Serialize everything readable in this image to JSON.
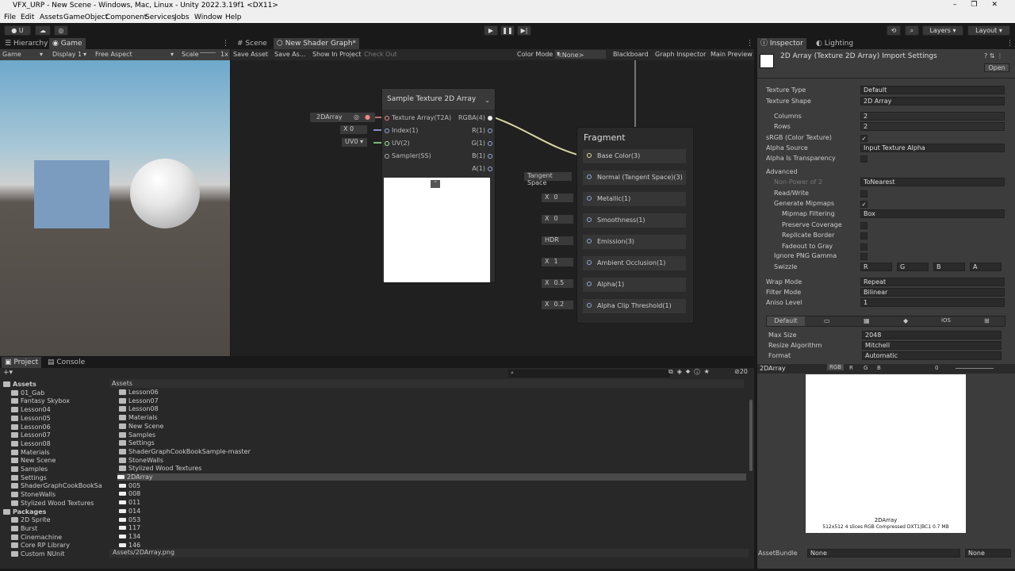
{
  "window": {
    "title": "VFX_URP - New Scene - Windows, Mac, Linux - Unity 2022.3.19f1 <DX11>"
  },
  "menu": [
    "File",
    "Edit",
    "Assets",
    "GameObject",
    "Component",
    "Services",
    "Jobs",
    "Window",
    "Help"
  ],
  "toolbar": {
    "account": "U",
    "layers": "Layers",
    "layout": "Layout"
  },
  "hierarchy_tabs": {
    "hierarchy": "Hierarchy",
    "game": "Game"
  },
  "game": {
    "mode": "Game",
    "display": "Display 1",
    "aspect": "Free Aspect",
    "scale_label": "Scale",
    "scale_value": "1x"
  },
  "sg_tabs": {
    "scene": "Scene",
    "shader": "New Shader Graph*"
  },
  "sg_toolbar": {
    "save": "Save Asset",
    "save_as": "Save As...",
    "show": "Show In Project",
    "checkout": "Check Out",
    "color_mode_label": "Color Mode",
    "color_mode": "<None>",
    "blackboard": "Blackboard",
    "graph_inspector": "Graph Inspector",
    "main_preview": "Main Preview"
  },
  "sample_node": {
    "title": "Sample Texture 2D Array",
    "inputs": [
      "Texture Array(T2A)",
      "Index(1)",
      "UV(2)",
      "Sampler(SS)"
    ],
    "outputs": [
      "RGBA(4)",
      "R(1)",
      "G(1)",
      "B(1)",
      "A(1)"
    ]
  },
  "prop_node": {
    "label": "2DArray",
    "index_x": "X",
    "index_val": "0",
    "uv": "UV0"
  },
  "fragment": {
    "title": "Fragment",
    "ports": [
      {
        "label": "Base Color(3)",
        "field": "",
        "val": ""
      },
      {
        "label": "Normal (Tangent Space)(3)",
        "field": "Tangent Space",
        "val": ""
      },
      {
        "label": "Metallic(1)",
        "field": "X",
        "val": "0"
      },
      {
        "label": "Smoothness(1)",
        "field": "X",
        "val": "0"
      },
      {
        "label": "Emission(3)",
        "field": "HDR",
        "val": ""
      },
      {
        "label": "Ambient Occlusion(1)",
        "field": "X",
        "val": "1"
      },
      {
        "label": "Alpha(1)",
        "field": "X",
        "val": "0.5"
      },
      {
        "label": "Alpha Clip Threshold(1)",
        "field": "X",
        "val": "0.2"
      }
    ]
  },
  "inspector_tabs": {
    "inspector": "Inspector",
    "lighting": "Lighting"
  },
  "inspector": {
    "title": "2D Array (Texture 2D Array) Import Settings",
    "open": "Open",
    "rows": [
      {
        "label": "Texture Type",
        "value": "Default"
      },
      {
        "label": "Texture Shape",
        "value": "2D Array"
      },
      {
        "label": "Columns",
        "value": "2"
      },
      {
        "label": "Rows",
        "value": "2"
      },
      {
        "label": "sRGB (Color Texture)",
        "value": "✓"
      },
      {
        "label": "Alpha Source",
        "value": "Input Texture Alpha"
      },
      {
        "label": "Alpha Is Transparency",
        "value": ""
      },
      {
        "label": "Advanced",
        "value": ""
      },
      {
        "label": "Non-Power of 2",
        "value": "ToNearest"
      },
      {
        "label": "Read/Write",
        "value": ""
      },
      {
        "label": "Generate Mipmaps",
        "value": "✓"
      },
      {
        "label": "Mipmap Filtering",
        "value": "Box"
      },
      {
        "label": "Preserve Coverage",
        "value": ""
      },
      {
        "label": "Replicate Border",
        "value": ""
      },
      {
        "label": "Fadeout to Gray",
        "value": ""
      },
      {
        "label": "Ignore PNG Gamma",
        "value": ""
      },
      {
        "label": "Swizzle",
        "value": "R"
      },
      {
        "label": "Wrap Mode",
        "value": "Repeat"
      },
      {
        "label": "Filter Mode",
        "value": "Bilinear"
      },
      {
        "label": "Aniso Level",
        "value": "1"
      }
    ],
    "swizzle": [
      "G",
      "B",
      "A"
    ],
    "platform_default": "Default",
    "platform_ios": "iOS",
    "max_size_label": "Max Size",
    "max_size": "2048",
    "resize_label": "Resize Algorithm",
    "resize": "Mitchell",
    "format_label": "Format",
    "format": "Automatic",
    "preview_name": "2DArray",
    "rgb": "RGB",
    "r": "R",
    "g": "G",
    "b": "B",
    "mip": "0",
    "preview_caption1": "2DArray",
    "preview_caption2": "512x512 4 slices RGB Compressed DXT1|BC1 0.7 MB",
    "assetbundle_label": "AssetBundle",
    "assetbundle": "None",
    "variant": "None"
  },
  "project_tabs": {
    "project": "Project",
    "console": "Console"
  },
  "project_tree": [
    "Assets",
    "01_Gab",
    "Fantasy Skybox",
    "Lesson04",
    "Lesson05",
    "Lesson06",
    "Lesson07",
    "Lesson08",
    "Materials",
    "New Scene",
    "Samples",
    "Settings",
    "ShaderGraphCookBookSa",
    "StoneWalls",
    "Stylized Wood Textures",
    "Packages",
    "2D Sprite",
    "Burst",
    "Cinemachine",
    "Core RP Library",
    "Custom NUnit"
  ],
  "breadcrumb": "Assets",
  "project_files": [
    "Lesson06",
    "Lesson07",
    "Lesson08",
    "Materials",
    "New Scene",
    "Samples",
    "Settings",
    "ShaderGraphCookBookSample-master",
    "StoneWalls",
    "Stylized Wood Textures",
    "2DArray",
    "005",
    "008",
    "011",
    "014",
    "053",
    "117",
    "134",
    "146"
  ],
  "project_path": "Assets/2DArray.png",
  "hidden_count": "20"
}
